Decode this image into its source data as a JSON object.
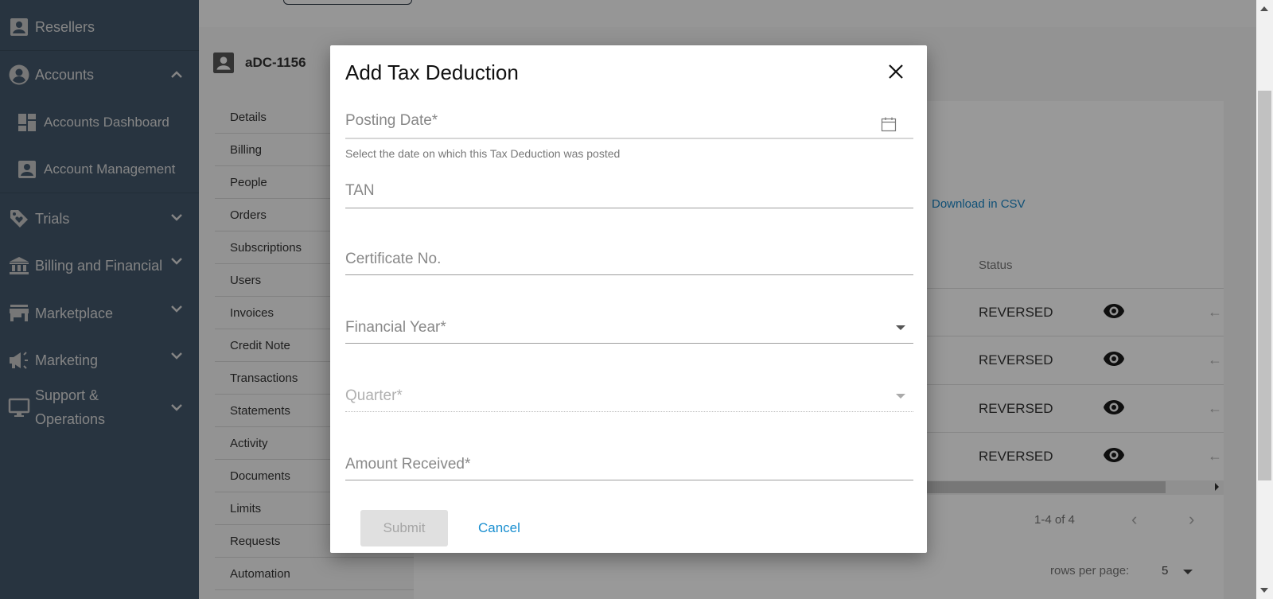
{
  "sidebar": {
    "items": [
      {
        "label": "Resellers",
        "icon": "person-badge-icon"
      },
      {
        "label": "Accounts",
        "icon": "account-circle-icon",
        "expanded": true
      },
      {
        "label": "Accounts Dashboard",
        "icon": "dashboard-icon",
        "sub": true
      },
      {
        "label": "Account Management",
        "icon": "person-badge-icon",
        "sub": true
      },
      {
        "label": "Trials",
        "icon": "tag-icon"
      },
      {
        "label": "Billing and Financial",
        "icon": "bank-icon"
      },
      {
        "label": "Marketplace",
        "icon": "store-icon"
      },
      {
        "label": "Marketing",
        "icon": "megaphone-icon"
      },
      {
        "label": "Support & Operations",
        "label_line1": "Support &",
        "label_line2": "Operations",
        "icon": "monitor-icon"
      }
    ]
  },
  "account": {
    "id": "aDC-1156"
  },
  "tabs": [
    "Details",
    "Billing",
    "People",
    "Orders",
    "Subscriptions",
    "Users",
    "Invoices",
    "Credit Note",
    "Transactions",
    "Statements",
    "Activity",
    "Documents",
    "Limits",
    "Requests",
    "Automation"
  ],
  "table": {
    "download_label": "Download in CSV",
    "columns": [
      "Status"
    ],
    "rows": [
      {
        "status": "REVERSED"
      },
      {
        "status": "REVERSED"
      },
      {
        "status": "REVERSED"
      },
      {
        "status": "REVERSED"
      }
    ],
    "pagination": {
      "range": "1-4 of 4",
      "rows_per_page_label": "rows per page:",
      "rows_per_page": "5"
    }
  },
  "modal": {
    "title": "Add Tax Deduction",
    "fields": {
      "posting_date": {
        "label": "Posting Date*",
        "helper": "Select the date on which this Tax Deduction was posted",
        "value": ""
      },
      "tan": {
        "label": "TAN",
        "value": ""
      },
      "certificate_no": {
        "label": "Certificate No.",
        "value": ""
      },
      "financial_year": {
        "label": "Financial Year*",
        "value": ""
      },
      "quarter": {
        "label": "Quarter*",
        "value": "",
        "disabled": true
      },
      "amount_received": {
        "label": "Amount Received*",
        "value": ""
      }
    },
    "submit_label": "Submit",
    "cancel_label": "Cancel"
  },
  "colors": {
    "sidebar_bg": "#283440",
    "link_blue": "#1a8fd0",
    "overlay": "rgba(0,0,0,0.4)"
  }
}
